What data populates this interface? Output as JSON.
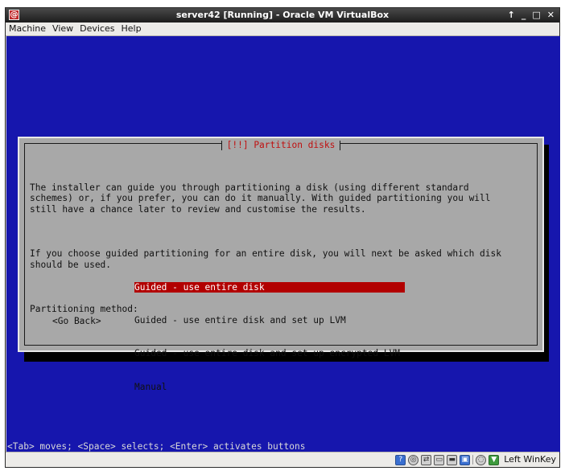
{
  "window": {
    "title": "server42 [Running] - Oracle VM VirtualBox",
    "controls": [
      "↑",
      "_",
      "□",
      "✕"
    ]
  },
  "menubar": {
    "items": [
      "Machine",
      "View",
      "Devices",
      "Help"
    ]
  },
  "installer": {
    "dialog_title": "[!!] Partition disks",
    "paragraph1": [
      "The installer can guide you through partitioning a disk (using different standard",
      "schemes) or, if you prefer, you can do it manually. With guided partitioning you will",
      "still have a chance later to review and customise the results."
    ],
    "paragraph2": [
      "If you choose guided partitioning for an entire disk, you will next be asked which disk",
      "should be used."
    ],
    "method_label": "Partitioning method:",
    "options": [
      "Guided - use entire disk",
      "Guided - use entire disk and set up LVM",
      "Guided - use entire disk and set up encrypted LVM",
      "Manual"
    ],
    "selected_index": 0,
    "go_back": "<Go Back>",
    "help_line": "<Tab> moves; <Space> selects; <Enter> activates buttons"
  },
  "statusbar": {
    "icons": [
      "hard-disk-icon",
      "optical-disk-icon",
      "network-icon",
      "usb-icon",
      "shared-folders-icon",
      "display-icon",
      "video-capture-icon",
      "mouse-integration-icon",
      "keyboard-capture-icon"
    ],
    "host_key": "Left WinKey"
  },
  "colors": {
    "vm_background": "#1616ad",
    "dialog_background": "#a8a8a8",
    "title_red": "#c01010",
    "selection": "#b20000"
  }
}
